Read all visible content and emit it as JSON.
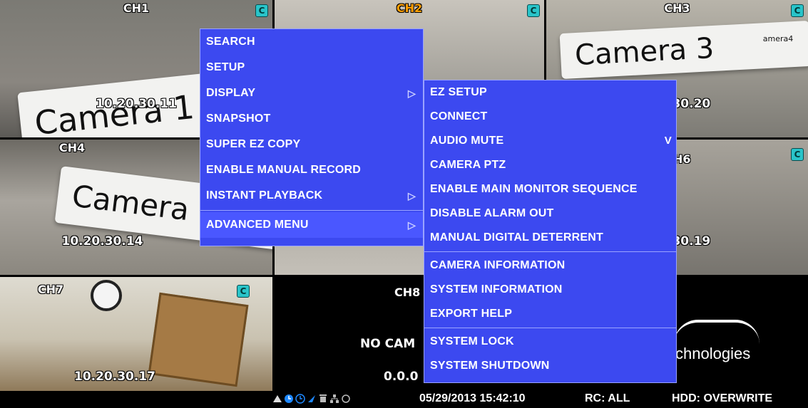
{
  "cameras": [
    {
      "ch": "CH1",
      "ip": "10.20.30.11",
      "sign": "Camera 1",
      "badge": "C"
    },
    {
      "ch": "CH2",
      "ip": "",
      "sign": "",
      "badge": "C"
    },
    {
      "ch": "CH3",
      "ip": "10.20.30.20",
      "sign": "Camera 3",
      "badge": "C"
    },
    {
      "ch": "CH4",
      "ip": "10.20.30.14",
      "sign": "Camera",
      "badge": ""
    },
    {
      "ch": "CH6",
      "ip": "10.20.30.19",
      "sign": "",
      "badge": "C"
    },
    {
      "ch": "CH7",
      "ip": "10.20.30.17",
      "sign": "",
      "badge": "C"
    },
    {
      "ch": "CH8",
      "ip": "0.0.0",
      "no_camera": "NO CAM",
      "logo": "chnologies"
    }
  ],
  "ip_fragments": {
    "ch3": ".30.20",
    "ch6": ".30.19",
    "ch6_label": "H6",
    "ch8_ip": "0.0.0",
    "ch8_no": "NO CAM"
  },
  "sign_small": "amera4",
  "main_menu": {
    "items": [
      "SEARCH",
      "SETUP",
      "DISPLAY",
      "SNAPSHOT",
      "SUPER EZ COPY",
      "ENABLE MANUAL RECORD",
      "INSTANT PLAYBACK",
      "ADVANCED MENU"
    ],
    "submenu_arrow": "▷"
  },
  "sub_menu": {
    "items": [
      "EZ SETUP",
      "CONNECT",
      "AUDIO MUTE",
      "CAMERA PTZ",
      "ENABLE MAIN MONITOR SEQUENCE",
      "DISABLE ALARM OUT",
      "MANUAL DIGITAL DETERRENT",
      "CAMERA INFORMATION",
      "SYSTEM INFORMATION",
      "EXPORT HELP",
      "SYSTEM LOCK",
      "SYSTEM SHUTDOWN"
    ],
    "checked_mark": "V"
  },
  "status_bar": {
    "datetime": "05/29/2013 15:42:10",
    "rc": "RC: ALL",
    "hdd": "HDD: OVERWRITE"
  },
  "colors": {
    "menu_bg": "#3c49f0",
    "active_ch": "#ffa000",
    "badge": "#29c4c9"
  }
}
